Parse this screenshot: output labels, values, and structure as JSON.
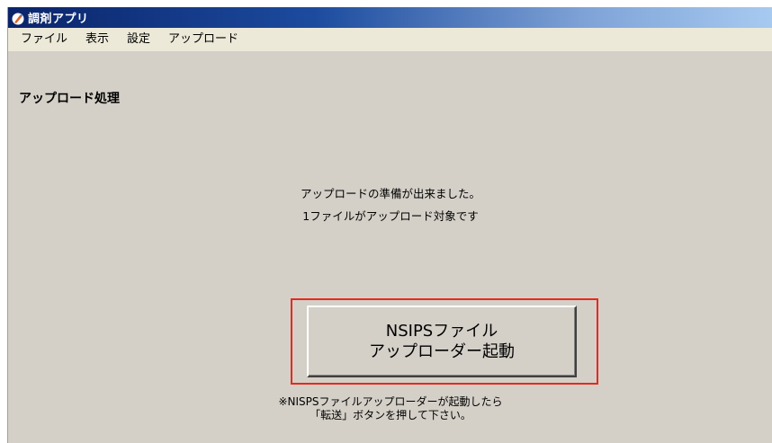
{
  "window": {
    "title": "調剤アプリ",
    "icon": "app-icon"
  },
  "menu": {
    "items": [
      {
        "label": "ファイル"
      },
      {
        "label": "表示"
      },
      {
        "label": "設定"
      },
      {
        "label": "アップロード"
      }
    ]
  },
  "main": {
    "page_title": "アップロード処理",
    "message_line1": "アップロードの準備が出来ました。",
    "message_line2": "1ファイルがアップロード対象です",
    "launch_button": {
      "line1": "NSIPSファイル",
      "line2": "アップローダー起動"
    },
    "note_line1": "※NISPSファイルアップローダーが起動したら",
    "note_line2": "「転送」ボタンを押して下さい。"
  },
  "colors": {
    "highlight": "#e8281e",
    "window_bg": "#d4d0c8",
    "titlebar_start": "#0a246a",
    "titlebar_end": "#a6caf0"
  }
}
